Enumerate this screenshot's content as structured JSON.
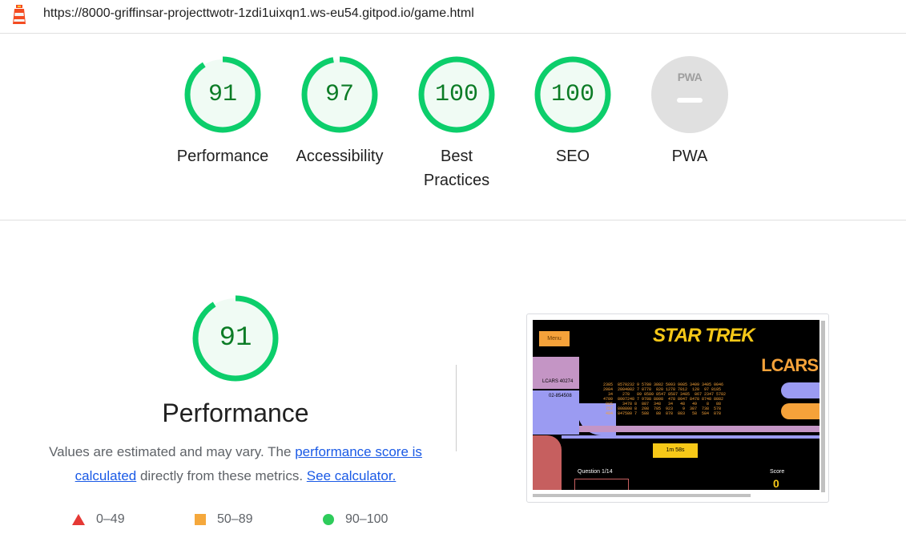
{
  "header": {
    "url": "https://8000-griffinsar-projecttwotr-1zdi1uixqn1.ws-eu54.gitpod.io/game.html"
  },
  "colors": {
    "pass": "#0cce6b",
    "pass_text": "#0c7c26",
    "average": "#ffa400",
    "fail": "#ff4e42",
    "link": "#1a5ae6"
  },
  "gauges": [
    {
      "score": "91",
      "label": "Performance",
      "fraction": 0.91
    },
    {
      "score": "97",
      "label": "Accessibility",
      "fraction": 0.97
    },
    {
      "score": "100",
      "label": "Best Practices",
      "fraction": 1.0
    },
    {
      "score": "100",
      "label": "SEO",
      "fraction": 1.0
    }
  ],
  "pwa": {
    "badge_text": "PWA",
    "label": "PWA"
  },
  "performance": {
    "score": "91",
    "fraction": 0.91,
    "title": "Performance",
    "desc_prefix": "Values are estimated and may vary. The ",
    "desc_link1": "performance score is calculated",
    "desc_middle": " directly from these metrics. ",
    "desc_link2": "See calculator."
  },
  "legend": [
    {
      "icon": "triangle-icon",
      "range": "0–49"
    },
    {
      "icon": "square-icon",
      "range": "50–89"
    },
    {
      "icon": "circle-icon",
      "range": "90–100"
    }
  ],
  "screenshot": {
    "menu_label": "Menu",
    "title": "STAR TREK",
    "lcars": "LCARS",
    "code1": "LCARS 40274",
    "code2": "02-854508",
    "timer": "1m 58s",
    "question": "Question 1/14",
    "score_label": "Score",
    "score_value": "0"
  }
}
